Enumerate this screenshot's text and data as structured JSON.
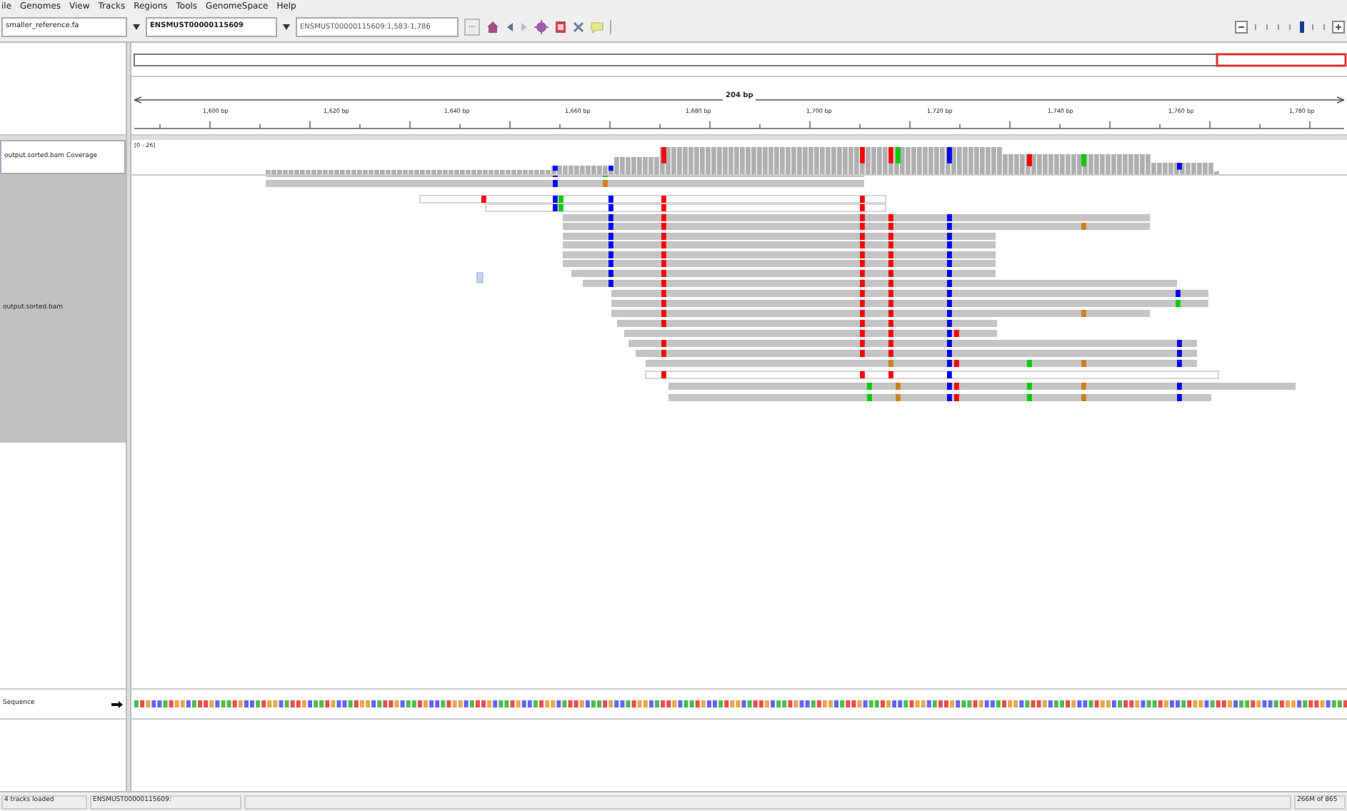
{
  "menu": [
    "ile",
    "Genomes",
    "View",
    "Tracks",
    "Regions",
    "Tools",
    "GenomeSpace",
    "Help"
  ],
  "toolbar": {
    "genome": "smaller_reference.fa",
    "chromosome": "ENSMUST00000115609",
    "locus": "ENSMUST00000115609:1,583-1,786",
    "more": "..."
  },
  "ruler": {
    "span": "204 bp",
    "ticks": [
      "1,600 bp",
      "1,620 bp",
      "1,640 bp",
      "1,660 bp",
      "1,680 bp",
      "1,700 bp",
      "1,720 bp",
      "1,740 bp",
      "1,760 bp",
      "1,780 bp"
    ]
  },
  "tracks": [
    {
      "name": "output.sorted.bam Coverage",
      "kind": "coverage",
      "range": "[0 - 26]"
    },
    {
      "name": "output.sorted.bam",
      "kind": "alignment"
    }
  ],
  "sequence_track": {
    "name": "Sequence"
  },
  "status_bar": {
    "message": "4 tracks loaded",
    "locus": "ENSMUST00000115609:",
    "memory": "266M of 865"
  }
}
